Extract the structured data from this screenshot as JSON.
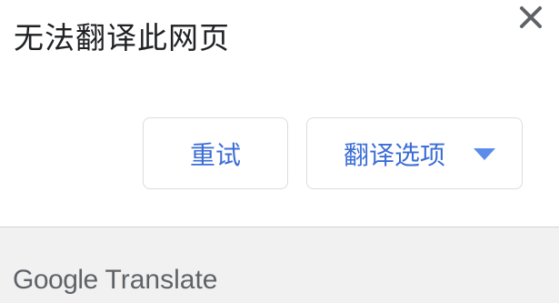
{
  "dialog": {
    "title": "无法翻译此网页",
    "close_icon": "close-icon"
  },
  "buttons": {
    "retry_label": "重试",
    "options_label": "翻译选项",
    "options_icon": "caret-down-icon"
  },
  "footer": {
    "brand_google": "Google",
    "brand_translate": "Translate"
  },
  "colors": {
    "accent": "#3c6ed6",
    "caret": "#5b8cec",
    "footer_bg": "#f1f1f1",
    "title_text": "#202124"
  }
}
